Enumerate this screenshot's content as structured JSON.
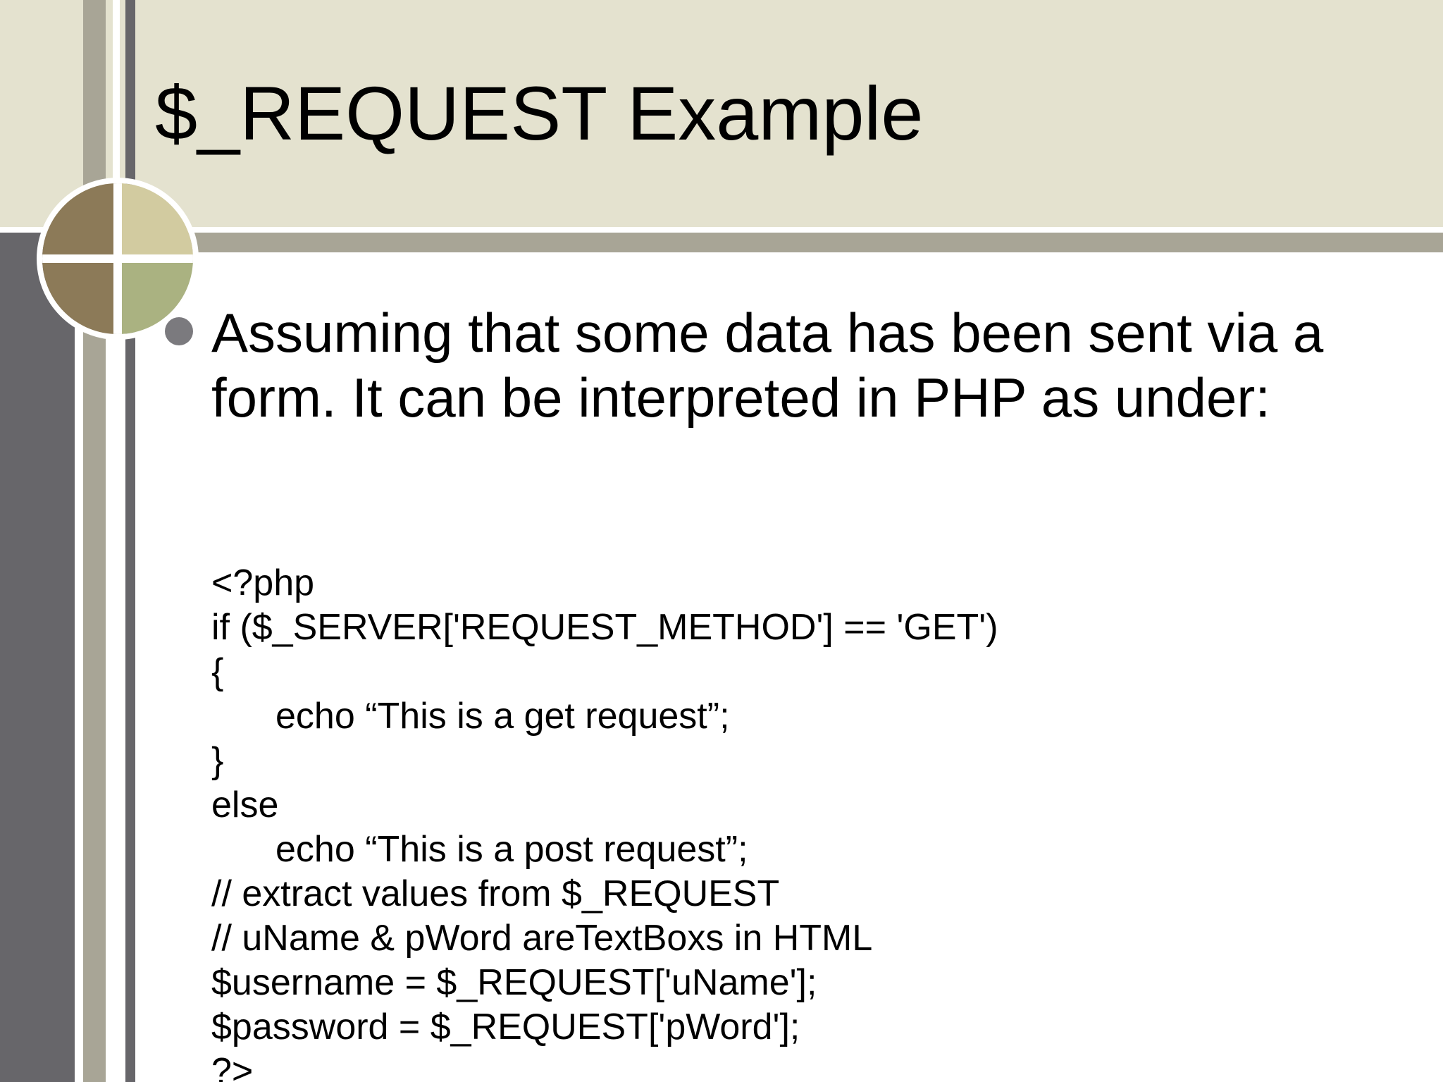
{
  "colors": {
    "header_background": "#e4e2cf",
    "header_stripe": "#a8a596",
    "left_bar": "#67666a",
    "vertical_bar_light": "#a8a596",
    "vertical_bar_dark": "#67666a",
    "circle_khaki": "#d2cba0",
    "circle_brown": "#8c7a58",
    "circle_olive": "#aab281",
    "bullet": "#7b7a7e",
    "text": "#000000"
  },
  "slide": {
    "title": "$_REQUEST Example",
    "bullet": {
      "icon": "circle-bullet",
      "text": "Assuming that some data has been sent via a form. It can be interpreted in PHP as under:"
    },
    "code_lines": [
      {
        "text": "<?php",
        "indent": false
      },
      {
        "text": "if ($_SERVER['REQUEST_METHOD'] == 'GET')",
        "indent": false
      },
      {
        "text": "{",
        "indent": false
      },
      {
        "text": "echo “This is a get request”;",
        "indent": true
      },
      {
        "text": "}",
        "indent": false
      },
      {
        "text": "else",
        "indent": false
      },
      {
        "text": "echo “This is a post request”;",
        "indent": true
      },
      {
        "text": "// extract values from $_REQUEST",
        "indent": false
      },
      {
        "text": "// uName & pWord areTextBoxs in HTML",
        "indent": false
      },
      {
        "text": "$username = $_REQUEST['uName'];",
        "indent": false
      },
      {
        "text": "$password = $_REQUEST['pWord'];",
        "indent": false
      },
      {
        "text": "?>",
        "indent": false
      }
    ]
  }
}
